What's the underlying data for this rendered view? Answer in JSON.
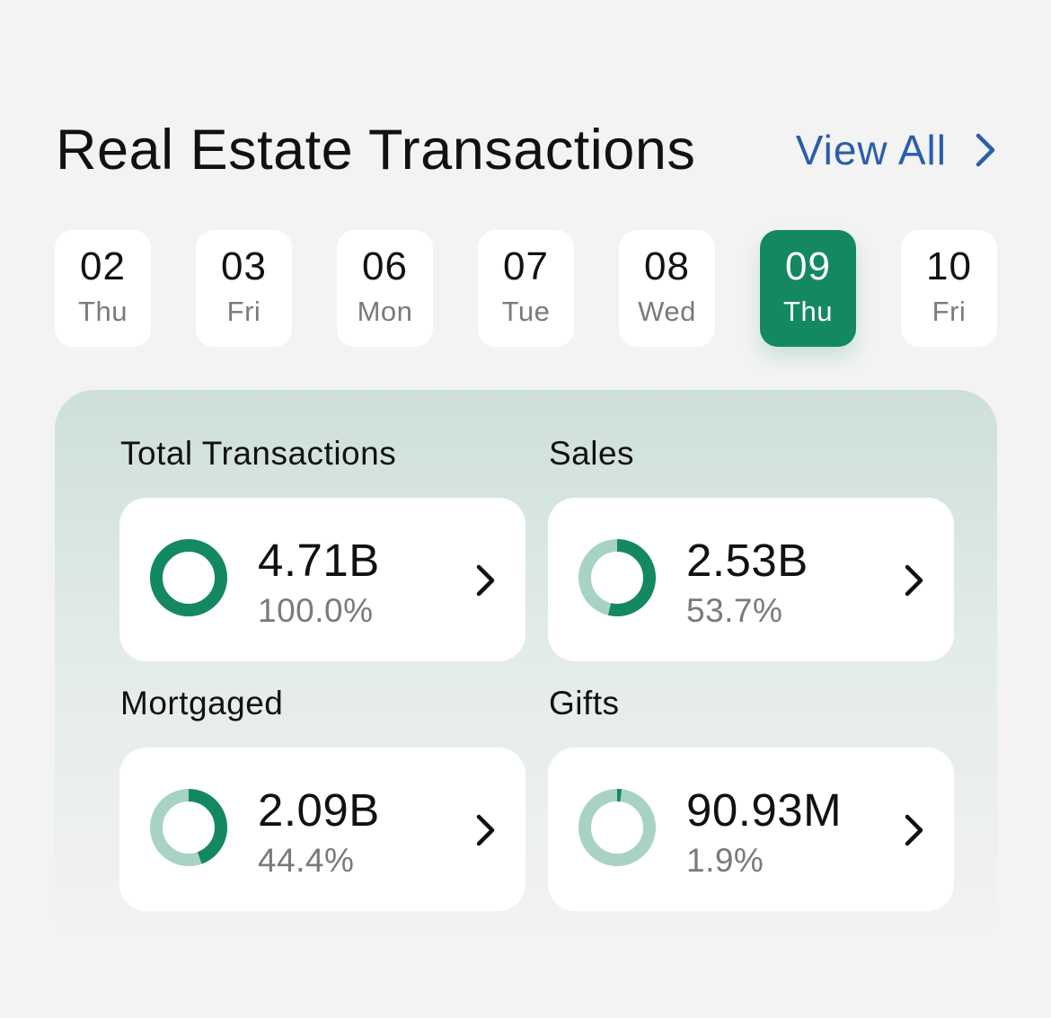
{
  "header": {
    "title": "Real Estate Transactions",
    "view_all_label": "View All"
  },
  "dates": [
    {
      "num": "02",
      "day": "Thu",
      "selected": false
    },
    {
      "num": "03",
      "day": "Fri",
      "selected": false
    },
    {
      "num": "06",
      "day": "Mon",
      "selected": false
    },
    {
      "num": "07",
      "day": "Tue",
      "selected": false
    },
    {
      "num": "08",
      "day": "Wed",
      "selected": false
    },
    {
      "num": "09",
      "day": "Thu",
      "selected": true
    },
    {
      "num": "10",
      "day": "Fri",
      "selected": false
    }
  ],
  "stats": [
    {
      "label": "Total Transactions",
      "value": "4.71B",
      "percent_text": "100.0%",
      "fraction": 1.0
    },
    {
      "label": "Sales",
      "value": "2.53B",
      "percent_text": "53.7%",
      "fraction": 0.537
    },
    {
      "label": "Mortgaged",
      "value": "2.09B",
      "percent_text": "44.4%",
      "fraction": 0.444
    },
    {
      "label": "Gifts",
      "value": "90.93M",
      "percent_text": "1.9%",
      "fraction": 0.019
    }
  ],
  "colors": {
    "accent": "#148862",
    "ring_track": "#a8d3c3",
    "link": "#2a5ea8"
  },
  "icons": {
    "view_all": "chevron-right-icon",
    "card": "chevron-right-icon",
    "ring": "donut-ring-icon"
  }
}
